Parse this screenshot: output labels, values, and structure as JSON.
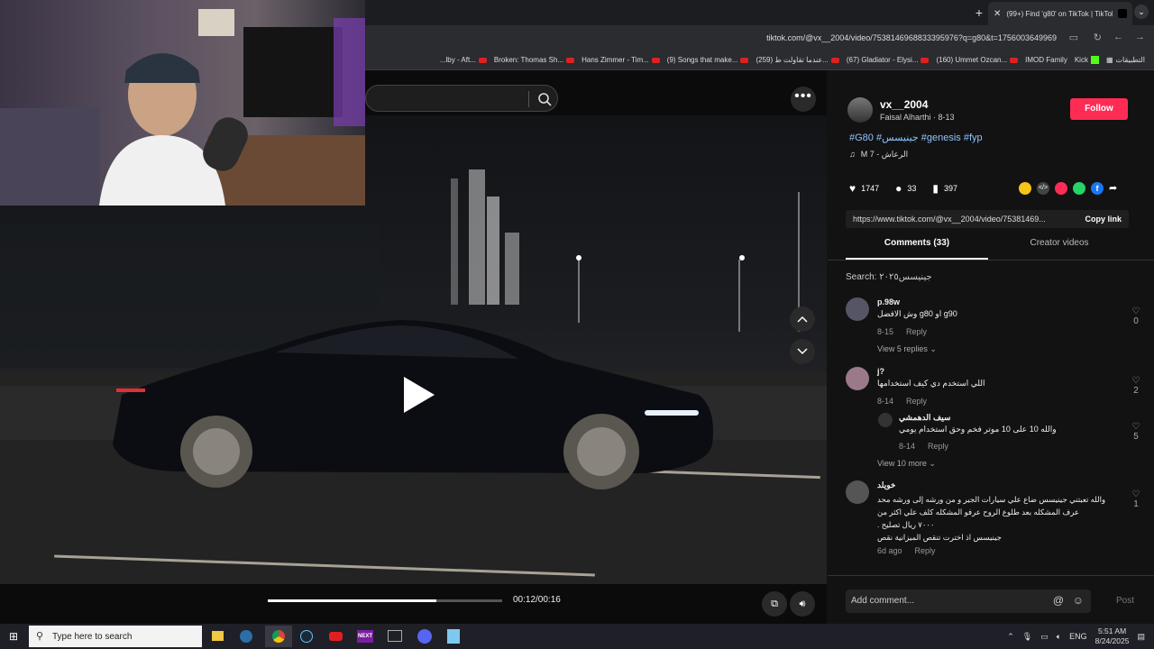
{
  "browser": {
    "tab_title": "(99+) Find 'g80' on TikTok | TikTok",
    "new_tab": "+",
    "url": "tiktok.com/@vx__2004/video/7538146968833395976?q=g80&t=1756003649969",
    "bookmarks": [
      {
        "label": "...lby - Aft...",
        "yt": true
      },
      {
        "label": "Broken: Thomas Sh...",
        "yt": true
      },
      {
        "label": "Hans Zimmer - Tim...",
        "yt": true
      },
      {
        "label": "(9) Songs that make...",
        "yt": true
      },
      {
        "label": "(259) عندما تقاولت ط...",
        "yt": true
      },
      {
        "label": "(67) Gladiator - Elysi...",
        "yt": true
      },
      {
        "label": "(160) Ummet Ozcan...",
        "yt": true
      },
      {
        "label": "IMOD Family",
        "yt": false
      },
      {
        "label": "Kick",
        "yt": false
      },
      {
        "label": "التطبيقات",
        "yt": false
      }
    ]
  },
  "video": {
    "time": "00:12/00:16",
    "progress": 0.72
  },
  "author": {
    "username": "vx__2004",
    "display": "Faisal Alharthi · 8-13",
    "follow_label": "Follow",
    "caption": "#G80 #جينيسس #genesis #fyp",
    "music": "M 7 - الرعاش",
    "likes": "1747",
    "comments": "33",
    "saves": "397",
    "link": "https://www.tiktok.com/@vx__2004/video/75381469...",
    "copy_label": "Copy link"
  },
  "tabs": {
    "comments": "Comments (33)",
    "creator": "Creator videos"
  },
  "search_label": "Search: جينيسس٢٠٢٥",
  "comments": [
    {
      "user": "p.98w",
      "text": "وش الافضل g80 او g90",
      "date": "8-15",
      "reply": "Reply",
      "likes": "0",
      "more": "View 5 replies"
    },
    {
      "user": "j?",
      "text": "اللي استخدم دي كيف استخدامها",
      "date": "8-14",
      "reply": "Reply",
      "likes": "2"
    },
    {
      "user": "سيف الدهمشي",
      "text": "والله 10 على 10 موتر فخم وحق استخدام يومي",
      "date": "8-14",
      "reply": "Reply",
      "likes": "5",
      "more": "View 10 more"
    },
    {
      "user": "خويلد",
      "lines": [
        "والله تعبتني جينيسس ضاع علي سيارات الجير و من ورشه إلى ورشه محد",
        "عرف المشكله بعد طلوع الروح عرفو المشكله كلف علي اكثر من",
        "٧٠٠٠ ريال تصليح .",
        "جينيسس اذ اخترت تنقص الميزانية نقص"
      ],
      "date": "6d ago",
      "reply": "Reply",
      "likes": "1"
    }
  ],
  "add_comment": "Add comment...",
  "post_label": "Post",
  "taskbar": {
    "search": "Type here to search",
    "lang": "ENG",
    "time": "5:51 AM",
    "date": "8/24/2025"
  }
}
